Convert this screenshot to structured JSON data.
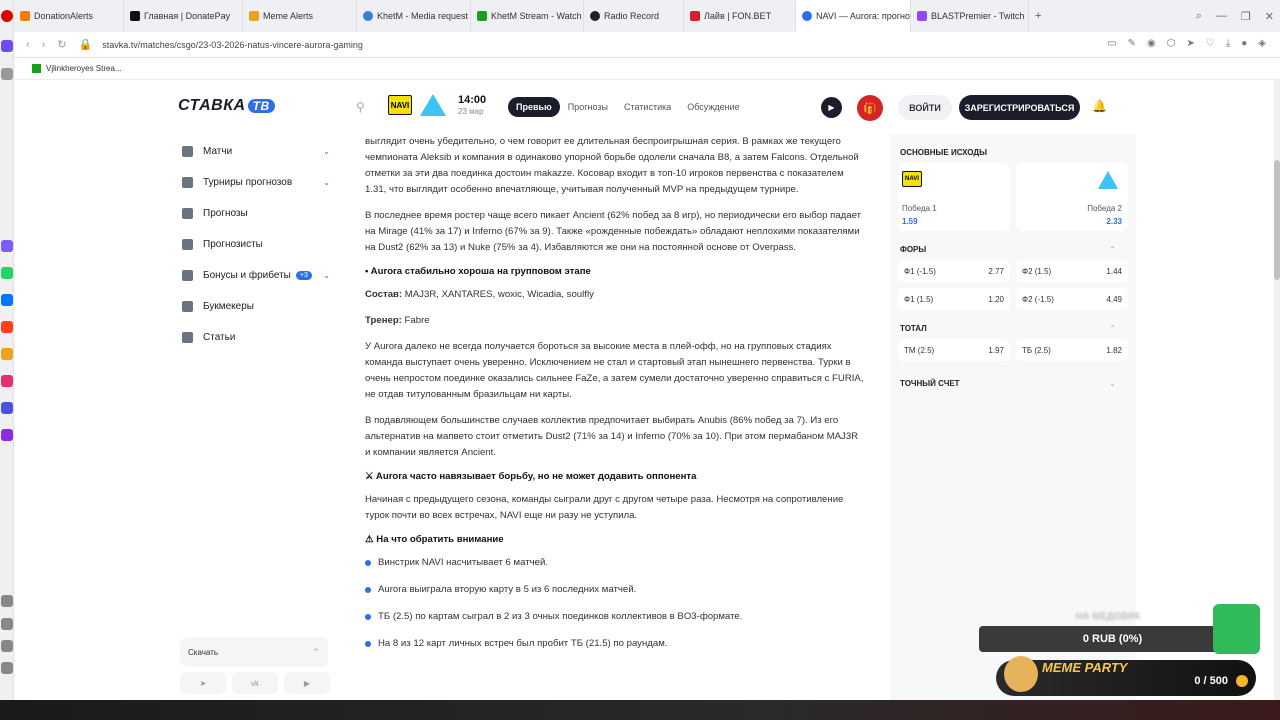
{
  "browser": {
    "tabs": [
      {
        "label": "DonationAlerts",
        "color": "#f57d07"
      },
      {
        "label": "Главная | DonatePay",
        "color": "#111111"
      },
      {
        "label": "Meme Alerts",
        "color": "#e8a317"
      },
      {
        "label": "KhetM - Media request",
        "color": "#3a7bd5"
      },
      {
        "label": "KhetM Stream - Watch Li",
        "color": "#1ca01c"
      },
      {
        "label": "Radio Record",
        "color": "#222222"
      },
      {
        "label": "Лайв | FON.BET",
        "color": "#d61f2c"
      },
      {
        "label": "NAVI — Aurora: прогноз",
        "color": "#2a6fe8"
      },
      {
        "label": "BLASTPremier - Twitch",
        "color": "#9146ff"
      }
    ],
    "new_tab": "+",
    "url": "stavka.tv/matches/csgo/23-03-2026-natus-vincere-aurora-gaming",
    "bookmark": "Vjlinkheroyes Strea..."
  },
  "header": {
    "logo_text": "СТАВКА",
    "logo_badge": "ТВ",
    "team1_abbr": "NAVI",
    "match_time": "14:00",
    "match_date": "23 мар",
    "tabs": [
      "Превью",
      "Прогнозы",
      "Статистика",
      "Обсуждение"
    ],
    "login": "ВОЙТИ",
    "register": "ЗАРЕГИСТРИРОВАТЬСЯ"
  },
  "leftnav": {
    "items": [
      {
        "label": "Матчи",
        "chevron": true
      },
      {
        "label": "Турниры прогнозов",
        "chevron": true
      },
      {
        "label": "Прогнозы"
      },
      {
        "label": "Прогнозисты"
      },
      {
        "label": "Бонусы и фрибеты",
        "badge": "+3",
        "chevron": true
      },
      {
        "label": "Букмекеры"
      },
      {
        "label": "Статьи"
      }
    ],
    "download": "Скачать"
  },
  "article": {
    "p1": "выглядит очень убедительно, о чем говорит ее длительная беспроигрышная серия. В рамках же текущего чемпионата Aleksib и компания в одинаково упорной борьбе одолели сначала B8, а затем Falcons. Отдельной отметки за эти два поединка достоин makazze. Косовар входит в топ-10 игроков первенства с показателем 1.31, что выглядит особенно впечатляюще, учитывая полученный MVP на предыдущем турнире.",
    "p2": "В последнее время ростер чаще всего пикает Ancient (62% побед за 8 игр), но периодически его выбор падает на Mirage (41% за 17) и Inferno (67% за 9). Также «рожденные побеждать» обладают неплохими показателями на Dust2 (62% за 13) и Nuke (75% за 4). Избавляются же они на постоянной основе от Overpass.",
    "h1": "• Aurora стабильно хороша на групповом этапе",
    "roster_label": "Состав:",
    "roster": " MAJ3R, XANTARES, woxic, Wicadia, soulfly",
    "coach_label": "Тренер:",
    "coach": " Fabre",
    "p3": "У Aurora далеко не всегда получается бороться за высокие места в плей-офф, но на групповых стадиях команда выступает очень уверенно. Исключением не стал и стартовый этап нынешнего первенства. Турки в очень непростом поединке оказались сильнее FaZe, а затем сумели достаточно уверенно справиться с FURIA, не отдав титулованным бразильцам ни карты.",
    "p4": "В подавляющем большинстве случаев коллектив предпочитает выбирать Anubis (86% побед за 7). Из его альтернатив на мапвето стоит отметить Dust2 (71% за 14) и Inferno (70% за 10). При этом пермабаном MAJ3R и компании является Ancient.",
    "h2": "⚔ Aurora часто навязывает борьбу, но не может додавить оппонента",
    "p5": "Начиная с предыдущего сезона, команды сыграли друг с другом четыре раза. Несмотря на сопротивление турок почти во всех встречах, NAVI еще ни разу не уступила.",
    "h3": "⚠ На что обратить внимание",
    "bullets": [
      "Винстрик NAVI насчитывает 6 матчей.",
      "Aurora выиграла вторую карту в 5 из 6 последних матчей.",
      "ТБ (2.5) по картам сыграл в 2 из 3 очных поединков коллективов в BO3-формате.",
      "На 8 из 12 карт личных встреч был пробит ТБ (21.5) по раундам."
    ]
  },
  "rightpanel": {
    "main_title": "ОСНОВНЫЕ ИСХОДЫ",
    "win1_label": "Победа 1",
    "win1_odd": "1.59",
    "win2_label": "Победа 2",
    "win2_odd": "2.33",
    "fora_title": "ФОРЫ",
    "fora": [
      [
        {
          "l": "Ф1 (-1.5)",
          "v": "2.77"
        },
        {
          "l": "Ф2 (1.5)",
          "v": "1.44"
        }
      ],
      [
        {
          "l": "Ф1 (1.5)",
          "v": "1.20"
        },
        {
          "l": "Ф2 (-1.5)",
          "v": "4.49"
        }
      ]
    ],
    "total_title": "ТОТАЛ",
    "total": [
      {
        "l": "ТМ (2.5)",
        "v": "1.97"
      },
      {
        "l": "ТБ (2.5)",
        "v": "1.82"
      }
    ],
    "exact_title": "ТОЧНЫЙ СЧЕТ"
  },
  "overlay": {
    "meme_label": "НА МЕДОВИК",
    "meme_amount": "0 RUB (0%)",
    "party_text": "MEME PARTY",
    "party_count": "0 / 500"
  }
}
